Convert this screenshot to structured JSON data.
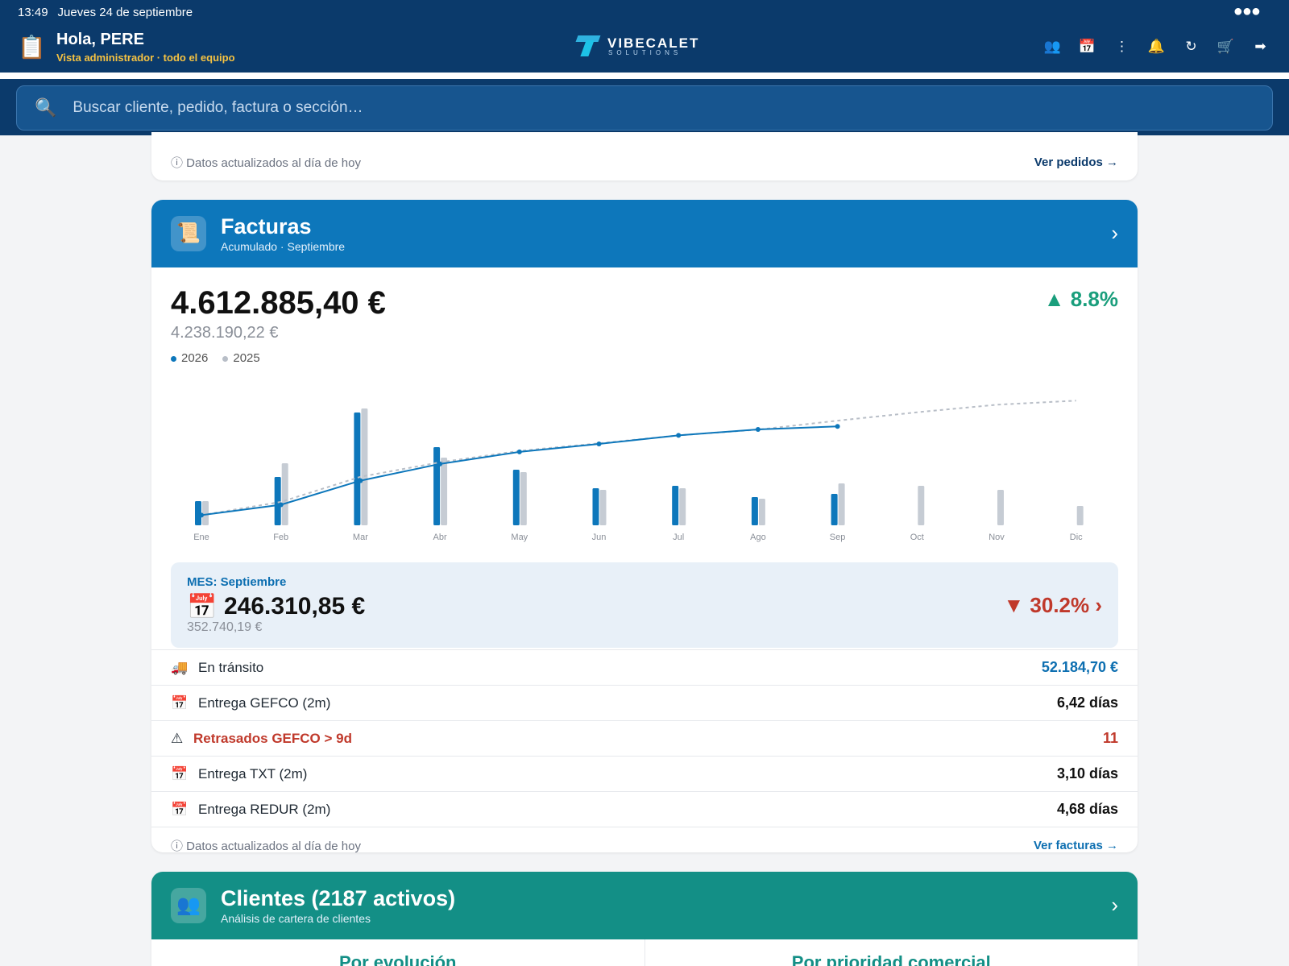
{
  "status": {
    "time": "13:49",
    "date": "Jueves 24 de septiembre"
  },
  "header": {
    "greeting": "Hola, PERE",
    "subtitle": "Vista administrador · todo el equipo",
    "brand": "VIBECALET",
    "brand_sub": "SOLUTIONS",
    "icons": [
      "users-icon",
      "calendar-icon",
      "kebab-menu-icon",
      "bell-icon",
      "refresh-icon",
      "cart-icon",
      "logout-icon"
    ]
  },
  "search": {
    "placeholder": "Buscar cliente, pedido, factura o sección…"
  },
  "pedidos_footer": {
    "updated": "ⓘ Datos actualizados al día de hoy",
    "link": "Ver pedidos →"
  },
  "facturas": {
    "title": "Facturas",
    "subtitle": "Acumulado · Septiembre",
    "total": "4.612.885,40 €",
    "total_prev": "4.238.190,22 €",
    "delta": "▲ 8.8%",
    "legend": [
      "2026",
      "2025"
    ],
    "month_label": "MES: Septiembre",
    "month_value": "246.310,85 €",
    "month_prev": "352.740,19 €",
    "month_delta": "▼ 30.2% ›",
    "kpis": [
      {
        "icon": "🚚",
        "label": "En tránsito",
        "value": "52.184,70 €"
      },
      {
        "icon": "📅",
        "label": "Entrega GEFCO (2m)",
        "value": "6,42 días"
      },
      {
        "icon": "⚠",
        "label": "Retrasados GEFCO > 9d",
        "value": "11"
      },
      {
        "icon": "📅",
        "label": "Entrega TXT (2m)",
        "value": "3,10 días"
      },
      {
        "icon": "📅",
        "label": "Entrega REDUR (2m)",
        "value": "4,68 días"
      }
    ],
    "updated": "ⓘ Datos actualizados al día de hoy",
    "link": "Ver facturas →"
  },
  "clientes": {
    "title": "Clientes (2187 activos)",
    "subtitle": "Análisis de cartera de clientes",
    "tabs": [
      "Por evolución",
      "Por prioridad comercial"
    ]
  },
  "colors": {
    "primary": "#0b3a6b",
    "facturas": "#0d77bb",
    "clientes": "#138f86",
    "up": "#1a9e7c",
    "down": "#c0392b",
    "bar_2026": "#0d77bb",
    "bar_2025": "#c6ccd4"
  },
  "chart_data": {
    "type": "bar",
    "categories": [
      "Ene",
      "Feb",
      "Mar",
      "Abr",
      "May",
      "Jun",
      "Jul",
      "Ago",
      "Sep",
      "Oct",
      "Nov",
      "Dic"
    ],
    "series": [
      {
        "name": "2026",
        "values": [
          30,
          60,
          140,
          97,
          69,
          46,
          49,
          35,
          39,
          null,
          null,
          null
        ]
      },
      {
        "name": "2025",
        "values": [
          30,
          77,
          145,
          84,
          66,
          44,
          46,
          33,
          52,
          49,
          44,
          24
        ]
      }
    ],
    "cumulative": [
      {
        "name": "2026",
        "values": [
          0.26,
          0.77,
          1.95,
          2.77,
          3.36,
          3.75,
          4.17,
          4.46,
          4.61,
          null,
          null,
          null
        ]
      },
      {
        "name": "2025",
        "values": [
          0.26,
          0.91,
          2.14,
          2.85,
          3.41,
          3.78,
          4.17,
          4.45,
          4.89,
          5.3,
          5.67,
          5.87
        ]
      }
    ]
  }
}
